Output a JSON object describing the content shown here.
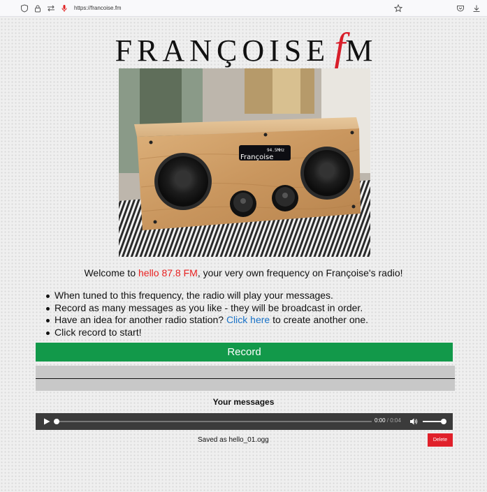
{
  "browser": {
    "url": "https://francoise.fm"
  },
  "site": {
    "logo_text": "FRANÇOISE",
    "logo_f": "f",
    "logo_m": "M",
    "photo_display_line1": "94.5MHz",
    "photo_display_line2": "Françoise"
  },
  "intro": {
    "welcome_prefix": "Welcome to ",
    "welcome_station": "hello 87.8 FM",
    "welcome_suffix": ", your very own frequency on Françoise's radio!",
    "bullet_1": "When tuned to this frequency, the radio will play your messages.",
    "bullet_2": "Record as many messages as you like - they will be broadcast in order.",
    "bullet_3_prefix": "Have an idea for another radio station? ",
    "bullet_3_link": "Click here",
    "bullet_3_suffix": " to create another one.",
    "bullet_4": "Click record to start!"
  },
  "recorder": {
    "record_label": "Record"
  },
  "messages": {
    "title": "Your messages",
    "player": {
      "current_time": "0:00",
      "separator": " / ",
      "duration": "0:04",
      "progress": 0,
      "volume": 1
    },
    "items": [
      {
        "saved_text": "Saved as hello_01.ogg",
        "delete_label": "Delete"
      }
    ]
  },
  "colors": {
    "accent_red": "#e81f1f",
    "record_green": "#12994a",
    "link_blue": "#1a73c8",
    "delete_red": "#e0202a"
  }
}
